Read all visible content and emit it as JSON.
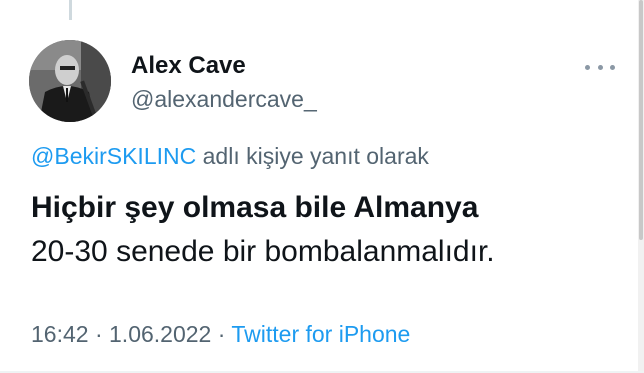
{
  "author": {
    "display_name": "Alex Cave",
    "handle": "@alexandercave_",
    "avatar_icon": "profile-photo-icon"
  },
  "reply_context": {
    "mention": "@BekirSKILINC",
    "suffix": " adlı kişiye yanıt olarak"
  },
  "tweet": {
    "line1": "Hiçbir şey olmasa bile Almanya",
    "line2": "20-30 senede bir bombalanmalıdır."
  },
  "meta": {
    "time": "16:42",
    "separator1": " · ",
    "date": "1.06.2022",
    "separator2": " · ",
    "source": "Twitter for iPhone"
  },
  "icons": {
    "more": "more-options-icon"
  },
  "colors": {
    "link": "#1d9bf0",
    "secondary_text": "#536471",
    "primary_text": "#0f1419",
    "background": "#ffffff"
  }
}
